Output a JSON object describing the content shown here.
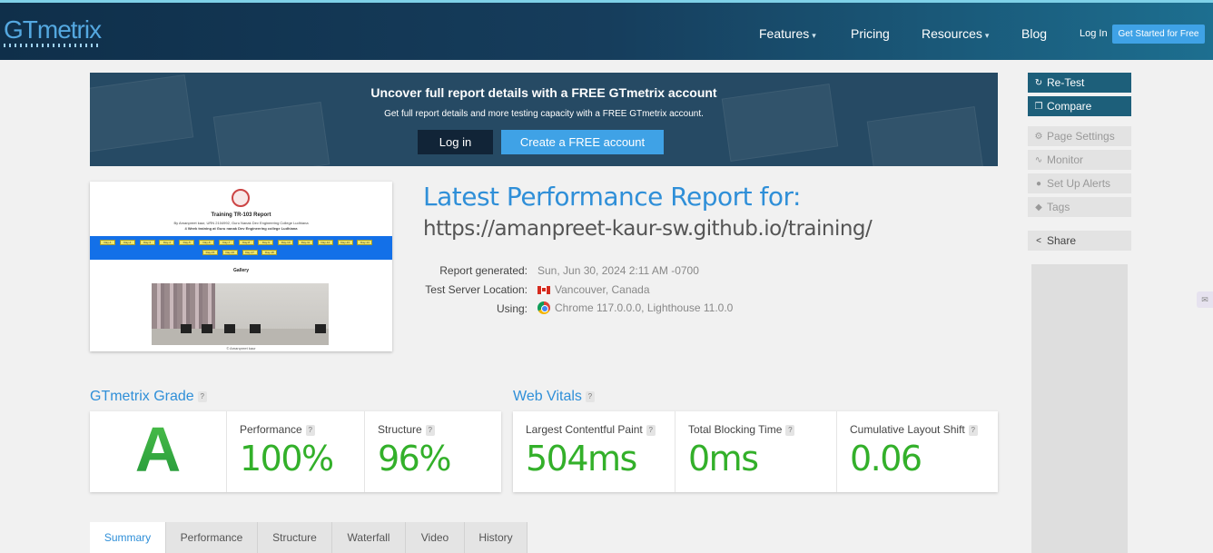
{
  "header": {
    "logo": "GTmetrix",
    "nav": {
      "features": "Features",
      "pricing": "Pricing",
      "resources": "Resources",
      "blog": "Blog",
      "login": "Log In",
      "get_started": "Get Started for Free"
    }
  },
  "banner": {
    "title": "Uncover full report details with a FREE GTmetrix account",
    "subtitle": "Get full report details and more testing capacity with a FREE GTmetrix account.",
    "login_label": "Log in",
    "create_label": "Create a FREE account"
  },
  "sidebar": {
    "retest": "Re-Test",
    "compare": "Compare",
    "page_settings": "Page Settings",
    "monitor": "Monitor",
    "alerts": "Set Up Alerts",
    "tags": "Tags",
    "share": "Share"
  },
  "thumbnail": {
    "title": "Training TR-103 Report",
    "line1": "By Amanpreet kaur, URN 2104992, Guru Nanak Dev Engineering College Ludhiana",
    "line2": "4 Week training at Guru nanak Dev Engineering college Ludhiana",
    "day_buttons": [
      "Day-1",
      "Day-2",
      "Day-3",
      "Day-4",
      "Day-5",
      "Day-6",
      "Day-7",
      "Day-8",
      "Day-9",
      "Day-10",
      "Day-11",
      "Day-12",
      "Day-13",
      "Day-14",
      "Day-15",
      "Day-16",
      "Day-17",
      "Day-18"
    ],
    "gallery": "Gallery",
    "credit": "© Amanpreet kaur"
  },
  "report": {
    "title": "Latest Performance Report for:",
    "url": "https://amanpreet-kaur-sw.github.io/training/",
    "generated_label": "Report generated:",
    "generated_value": "Sun, Jun 30, 2024 2:11 AM -0700",
    "location_label": "Test Server Location:",
    "location_value": "Vancouver, Canada",
    "using_label": "Using:",
    "using_value": "Chrome 117.0.0.0, Lighthouse 11.0.0"
  },
  "grade": {
    "section_title": "GTmetrix Grade",
    "letter": "A",
    "performance_label": "Performance",
    "performance_value": "100%",
    "structure_label": "Structure",
    "structure_value": "96%"
  },
  "vitals": {
    "section_title": "Web Vitals",
    "lcp_label": "Largest Contentful Paint",
    "lcp_value": "504ms",
    "tbt_label": "Total Blocking Time",
    "tbt_value": "0ms",
    "cls_label": "Cumulative Layout Shift",
    "cls_value": "0.06"
  },
  "tabs": [
    "Summary",
    "Performance",
    "Structure",
    "Waterfall",
    "Video",
    "History"
  ],
  "help_mark": "?",
  "colors": {
    "accent_blue": "#2f8fd8",
    "good_green": "#33b02a",
    "header_dark": "#163d5c",
    "button_blue": "#3fa2e6"
  }
}
